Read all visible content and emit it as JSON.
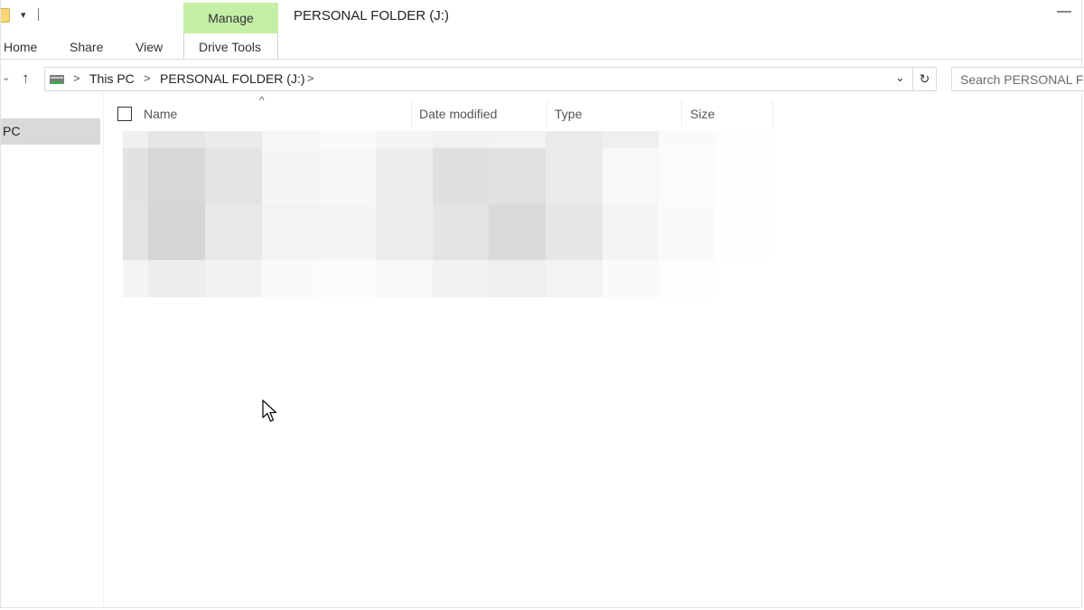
{
  "window": {
    "title": "PERSONAL FOLDER (J:)",
    "minimize_glyph": "—"
  },
  "quick_access": {
    "dropdown_glyph": "▾"
  },
  "ribbon": {
    "contextual_group": "Manage",
    "tabs": [
      "Home",
      "Share",
      "View",
      "Drive Tools"
    ],
    "contextual_color": "#c6efa6"
  },
  "navigation": {
    "recent_glyph": "⌄",
    "up_glyph": "↑",
    "breadcrumb": [
      "This PC",
      "PERSONAL FOLDER (J:)"
    ],
    "breadcrumb_separator": ">",
    "address_dropdown_glyph": "⌄",
    "refresh_glyph": "↻",
    "search_placeholder": "Search PERSONAL FOLDER (J:)"
  },
  "nav_pane": {
    "selected_item": "PC"
  },
  "file_list": {
    "columns": [
      "Name",
      "Date modified",
      "Type",
      "Size"
    ],
    "sort_indicator": "^",
    "sort_column": "Name",
    "content_state": "pixelated / redacted"
  },
  "redaction_palette": [
    "#f0f0f1",
    "#e6e6e7",
    "#ebebec",
    "#f6f6f7",
    "#f9f9f9",
    "#f5f5f6",
    "#f1f1f2",
    "#f3f3f4",
    "#eaeaeb",
    "#efeff0",
    "#fafafa",
    "#fdfdfd",
    "#e2e2e3",
    "#d7d7d8",
    "#e4e4e5",
    "#f5f5f6",
    "#f7f7f7",
    "#eeeeef",
    "#dfdfe0",
    "#e1e1e2",
    "#ebebec",
    "#f8f8f9",
    "#fbfbfb",
    "#fefefe",
    "#e3e3e5",
    "#d6d6d8",
    "#e8e8eb",
    "#f3f3f4",
    "#f5f5f5",
    "#ededee",
    "#e4e4e5",
    "#dadadc",
    "#e6e6e8",
    "#f4f4f5",
    "#fafafa",
    "#fefefe",
    "#f4f4f5",
    "#ededee",
    "#f2f2f3",
    "#fafafa",
    "#fcfcfc",
    "#f8f8f8",
    "#f2f2f3",
    "#efeff0",
    "#f3f3f4",
    "#fafafa",
    "#fdfdfd",
    "#ffffff"
  ]
}
